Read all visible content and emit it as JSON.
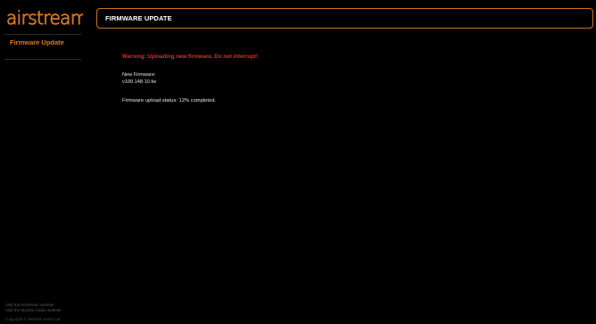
{
  "brand": {
    "logo_text": "airstream",
    "accent_color": "#e07a1f"
  },
  "sidebar": {
    "items": [
      {
        "label": "Firmware Update",
        "active": true
      }
    ],
    "footer_links": [
      "Visit the AirStream website",
      "Visit the Monitor Audio website"
    ],
    "copyright": "Copyright © Monitor Audio Ltd."
  },
  "header": {
    "title": "FIRMWARE UPDATE"
  },
  "main": {
    "warning": "Warning: Uploading new firmware. Do not interrupt!",
    "new_firmware_label": "New Firmware:",
    "new_firmware_value": "v100.148.10.fw",
    "status_text": "Firmware upload status: 12% completed.",
    "progress_percent": 12
  },
  "colors": {
    "background": "#000000",
    "warning": "#d6322a",
    "header_border": "#c8741f"
  }
}
